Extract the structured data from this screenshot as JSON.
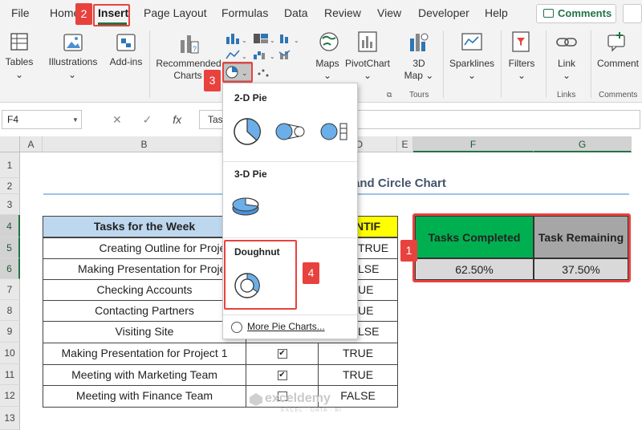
{
  "menu": {
    "tabs": [
      "File",
      "Home",
      "Insert",
      "Page Layout",
      "Formulas",
      "Data",
      "Review",
      "View",
      "Developer",
      "Help"
    ],
    "comments_label": "Comments"
  },
  "ribbon": {
    "tables": "Tables",
    "illustrations": "Illustrations",
    "addins": "Add-ins",
    "recommended_charts_1": "Recommended",
    "recommended_charts_2": "Charts",
    "maps": "Maps",
    "pivotchart": "PivotChart",
    "map3d_1": "3D",
    "map3d_2": "Map",
    "sparklines": "Sparklines",
    "filters": "Filters",
    "link": "Link",
    "comment": "Comment",
    "groups": {
      "tours": "Tours",
      "links": "Links",
      "comments": "Comments"
    }
  },
  "formula_bar": {
    "name_box": "F4",
    "fx": "fx",
    "content": "Tas"
  },
  "columns": [
    "A",
    "B",
    "C",
    "D",
    "E",
    "F",
    "G"
  ],
  "rows": [
    "1",
    "2",
    "3",
    "4",
    "5",
    "6",
    "7",
    "8",
    "9",
    "10",
    "11",
    "12",
    "13"
  ],
  "sheet": {
    "title_partial": "and Circle Chart",
    "table_header": "Tasks for the Week",
    "countif_header": "NTIF",
    "tasks": [
      "Creating Outline for Project 1",
      "Making Presentation for Project 1",
      "Checking Accounts",
      "Contacting Partners",
      "Visiting Site",
      "Making Presentation for Project 1",
      "Meeting with Marketing Team",
      "Meeting with Finance Team"
    ],
    "visible_checks": [
      "✔",
      "✔",
      ""
    ],
    "status_partial": [
      "TRUE",
      "LSE",
      "UE",
      "UE",
      "LSE"
    ],
    "status_full": [
      "TRUE",
      "TRUE",
      "FALSE"
    ]
  },
  "summary": {
    "completed_label": "Tasks Completed",
    "remaining_label": "Task Remaining",
    "completed_value": "62.50%",
    "remaining_value": "37.50%",
    "colors": {
      "completed": "#00b050",
      "remaining": "#a6a6a6"
    }
  },
  "dropdown": {
    "pie2d": "2-D Pie",
    "pie3d": "3-D Pie",
    "doughnut": "Doughnut",
    "more": "More Pie Charts..."
  },
  "badges": [
    "1",
    "2",
    "3",
    "4"
  ],
  "watermark": {
    "name": "exceldemy",
    "tagline": "EXCEL · DATA · BI"
  }
}
